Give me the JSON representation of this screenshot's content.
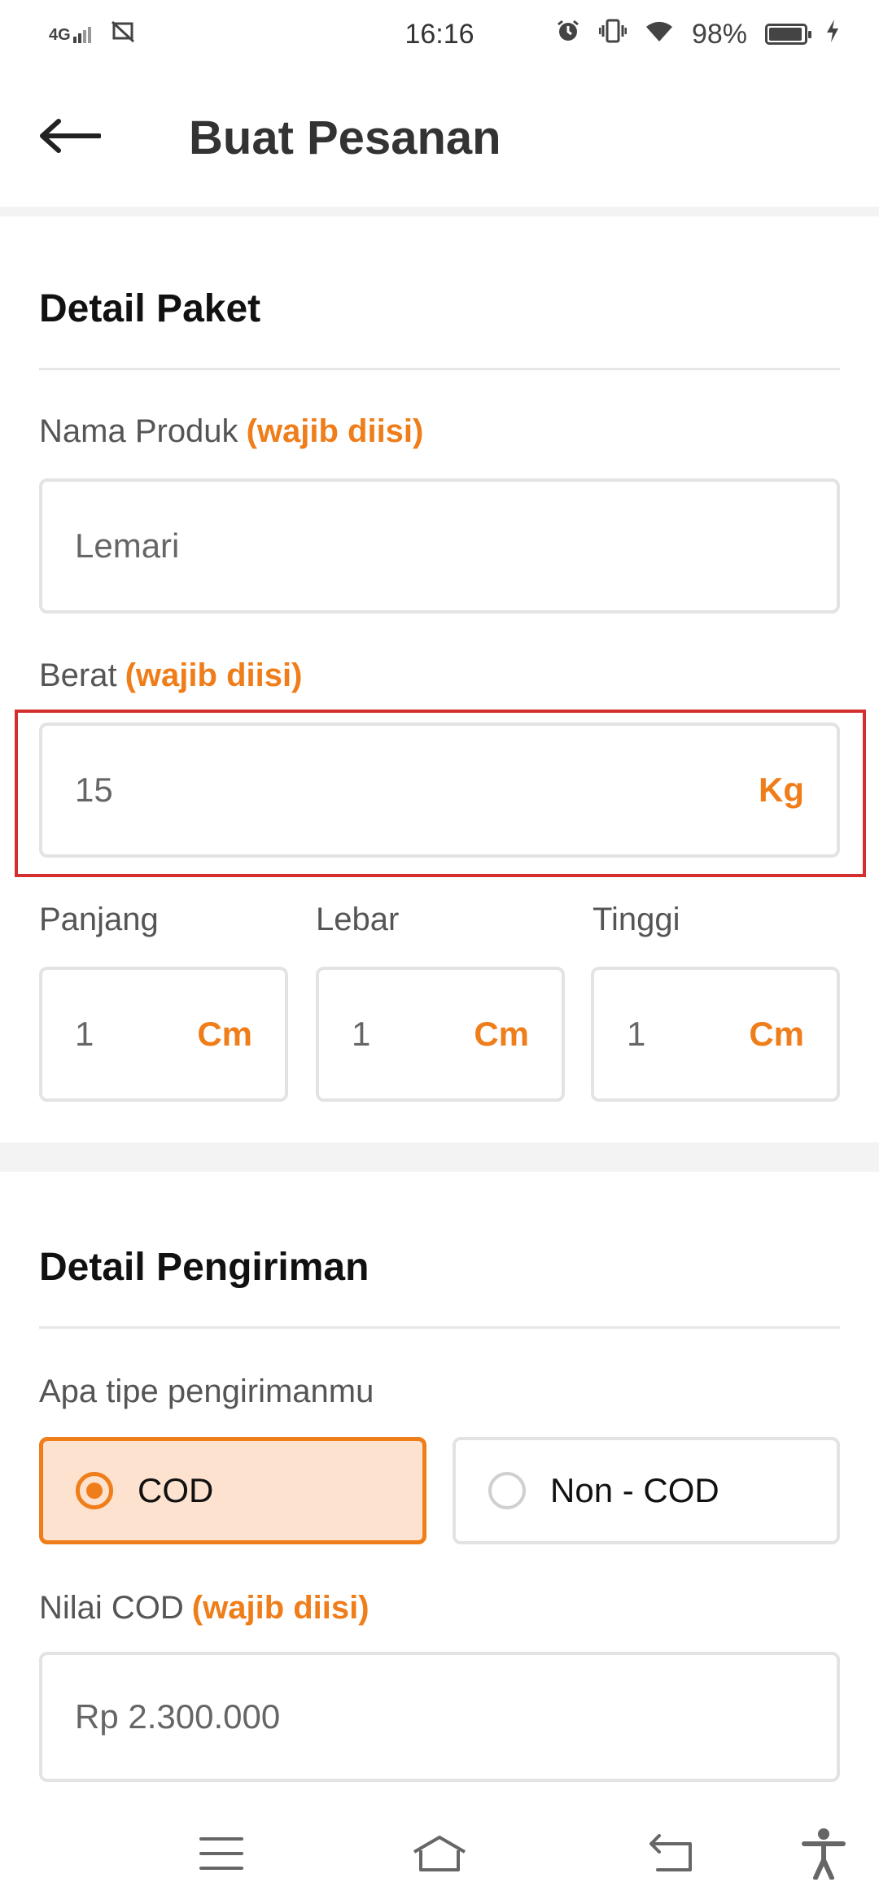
{
  "status_bar": {
    "network": "4G",
    "time": "16:16",
    "battery": "98%",
    "icons": [
      "signal-icon",
      "screenshot-icon",
      "alarm-icon",
      "vibrate-icon",
      "wifi-icon",
      "battery-icon",
      "charging-icon"
    ]
  },
  "app_bar": {
    "title": "Buat Pesanan",
    "back_icon": "arrow-left-icon"
  },
  "package_section": {
    "title": "Detail Paket",
    "product_name": {
      "label": "Nama Produk",
      "required": "(wajib diisi)",
      "value": "Lemari"
    },
    "weight": {
      "label": "Berat",
      "required": "(wajib diisi)",
      "value": "15",
      "unit": "Kg"
    },
    "length": {
      "label": "Panjang",
      "value": "1",
      "unit": "Cm"
    },
    "width": {
      "label": "Lebar",
      "value": "1",
      "unit": "Cm"
    },
    "height": {
      "label": "Tinggi",
      "value": "1",
      "unit": "Cm"
    }
  },
  "shipping_section": {
    "title": "Detail Pengiriman",
    "type_label": "Apa tipe pengirimanmu",
    "options": [
      {
        "label": "COD",
        "selected": true
      },
      {
        "label": "Non - COD",
        "selected": false
      }
    ],
    "cod_value": {
      "label": "Nilai COD",
      "required": "(wajib diisi)",
      "value": "Rp 2.300.000"
    }
  },
  "nav_bar": {
    "icons": [
      "menu-icon",
      "home-icon",
      "back-icon",
      "accessibility-icon"
    ]
  },
  "colors": {
    "accent": "#ef7d1a",
    "selected_bg": "#fde3cf",
    "highlight": "#d32f2f"
  }
}
